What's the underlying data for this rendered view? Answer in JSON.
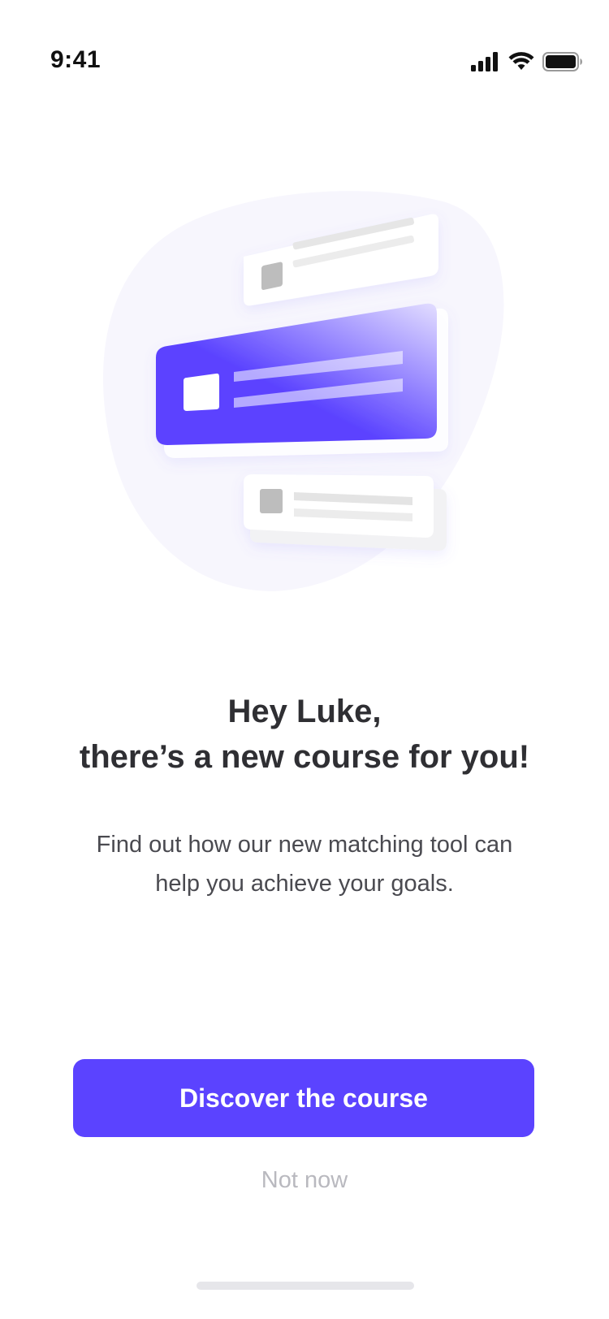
{
  "status_bar": {
    "time": "9:41",
    "icons": [
      "signal-icon",
      "wifi-icon",
      "battery-icon"
    ]
  },
  "illustration": {
    "blob_color": "#f7f6fd",
    "card_color": "#ffffff",
    "accent_start": "#5b43ff",
    "accent_end": "#d9d4ff",
    "placeholder_gray": "#bdbdbd"
  },
  "headline": {
    "line1": "Hey Luke,",
    "line2": "there’s a new course for you!"
  },
  "description": "Find out how our new matching tool can help you achieve your goals.",
  "actions": {
    "primary_label": "Discover the course",
    "secondary_label": "Not now",
    "primary_color": "#5b43ff"
  }
}
